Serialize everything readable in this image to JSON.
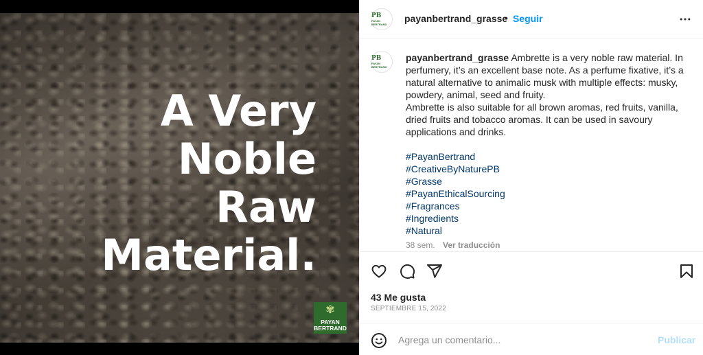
{
  "post_image": {
    "headline_lines": [
      "A Very",
      "Noble",
      "Raw",
      "Material."
    ],
    "logo_lines": [
      "PAYAN",
      "BERTRAND"
    ]
  },
  "header": {
    "avatar_monogram": "PB",
    "avatar_sub": "PAYAN BERTRAND",
    "username": "payanbertrand_grasse",
    "separator": "•",
    "follow_label": "Seguir",
    "more_icon": "more-horizontal-icon"
  },
  "caption": {
    "username": "payanbertrand_grasse",
    "paragraph1": "Ambrette is a very noble raw material. In perfumery, it’s an excellent base note. As a perfume fixative, it’s a natural alternative to animalic musk with multiple effects: musky, powdery, animal, seed and fruity.",
    "paragraph2": "Ambrette is also suitable for all brown aromas, red fruits, vanilla, dried fruits and tobacco aromas. It can be used in savoury applications and drinks.",
    "hashtags": [
      "#PayanBertrand",
      "#CreativeByNaturePB",
      "#Grasse",
      "#PayanEthicalSourcing",
      "#Fragrances",
      "#Ingredients",
      "#Natural"
    ],
    "age": "38 sem.",
    "translate_label": "Ver traducción"
  },
  "actions": {
    "like_icon": "heart-icon",
    "comment_icon": "comment-icon",
    "share_icon": "send-icon",
    "save_icon": "bookmark-icon"
  },
  "likes_text": "43 Me gusta",
  "date_text": "SEPTIEMBRE 15, 2022",
  "comment_bar": {
    "emoji_icon": "emoji-icon",
    "placeholder": "Agrega un comentario...",
    "publish_label": "Publicar"
  },
  "colors": {
    "link_blue": "#0095f6",
    "hashtag_blue": "#00376b",
    "publish_disabled": "#b2dffc",
    "brand_green": "#2f6b2d"
  }
}
